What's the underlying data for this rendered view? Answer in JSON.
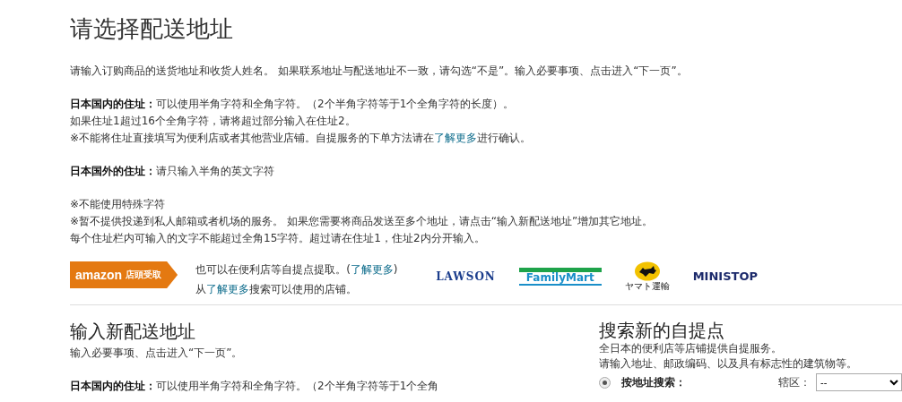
{
  "page_title": "请选择配送地址",
  "intro": [
    {
      "kind": "plain",
      "text": "请输入订购商品的送货地址和收货人姓名。 如果联系地址与配送地址不一致，请勾选“不是”。输入必要事项、点击进入“下一页”。"
    }
  ],
  "domestic_rules": [
    [
      {
        "kind": "strong",
        "text": "日本国内的住址："
      },
      {
        "kind": "plain",
        "text": "可以使用半角字符和全角字符。（2个半角字符等于1个全角字符的长度）。"
      }
    ],
    [
      {
        "kind": "plain",
        "text": "如果住址1超过16个全角字符，请将超过部分输入在住址2。"
      }
    ],
    [
      {
        "kind": "plain",
        "text": "※不能将住址直接填写为便利店或者其他营业店铺。自提服务的下单方法请在"
      },
      {
        "kind": "link",
        "text": "了解更多"
      },
      {
        "kind": "plain",
        "text": "进行确认。"
      }
    ]
  ],
  "overseas_rules": [
    [
      {
        "kind": "strong",
        "text": "日本国外的住址："
      },
      {
        "kind": "plain",
        "text": "请只输入半角的英文字符"
      }
    ]
  ],
  "notes": [
    [
      {
        "kind": "plain",
        "text": "※不能使用特殊字符"
      }
    ],
    [
      {
        "kind": "plain",
        "text": "※暂不提供投递到私人邮箱或者机场的服务。 如果您需要将商品发送至多个地址，请点击“输入新配送地址”增加其它地址。"
      }
    ],
    [
      {
        "kind": "plain",
        "text": "每个住址栏内可输入的文字不能超过全角15字符。超过请在住址1，住址2内分开输入。"
      }
    ]
  ],
  "pickup_banner": {
    "badge": {
      "brand": "amazon",
      "service": "店頭受取"
    },
    "lines": [
      [
        {
          "kind": "plain",
          "text": "也可以在便利店等自提点提取。("
        },
        {
          "kind": "link",
          "text": "了解更多"
        },
        {
          "kind": "plain",
          "text": ")"
        }
      ],
      [
        {
          "kind": "plain",
          "text": "从"
        },
        {
          "kind": "link",
          "text": "了解更多"
        },
        {
          "kind": "plain",
          "text": "搜索可以使用的店铺。"
        }
      ]
    ],
    "stores": [
      {
        "kind": "lawson",
        "name": "LAWSON"
      },
      {
        "kind": "familymart",
        "name": "FamilyMart"
      },
      {
        "kind": "yamato",
        "name": "ヤマト運輸"
      },
      {
        "kind": "ministop",
        "name": "MINISTOP"
      }
    ]
  },
  "new_address": {
    "title": "输入新配送地址",
    "lines": [
      [
        {
          "kind": "plain",
          "text": "输入必要事项、点击进入“下一页”。"
        }
      ],
      [
        {
          "kind": "strong",
          "text": "日本国内的住址："
        },
        {
          "kind": "plain",
          "text": "可以使用半角字符和全角字符。（2个半角字符等于1个全角"
        }
      ]
    ]
  },
  "pickup_search": {
    "title": "搜索新的自提点",
    "lines": [
      [
        {
          "kind": "plain",
          "text": "全日本的便利店等店铺提供自提服务。"
        }
      ],
      [
        {
          "kind": "plain",
          "text": "请输入地址、邮政编码、以及具有标志性的建筑物等。"
        }
      ]
    ],
    "option": {
      "label": "按地址搜索：",
      "selected": true
    },
    "region": {
      "label": "辖区：",
      "value": "--"
    }
  }
}
